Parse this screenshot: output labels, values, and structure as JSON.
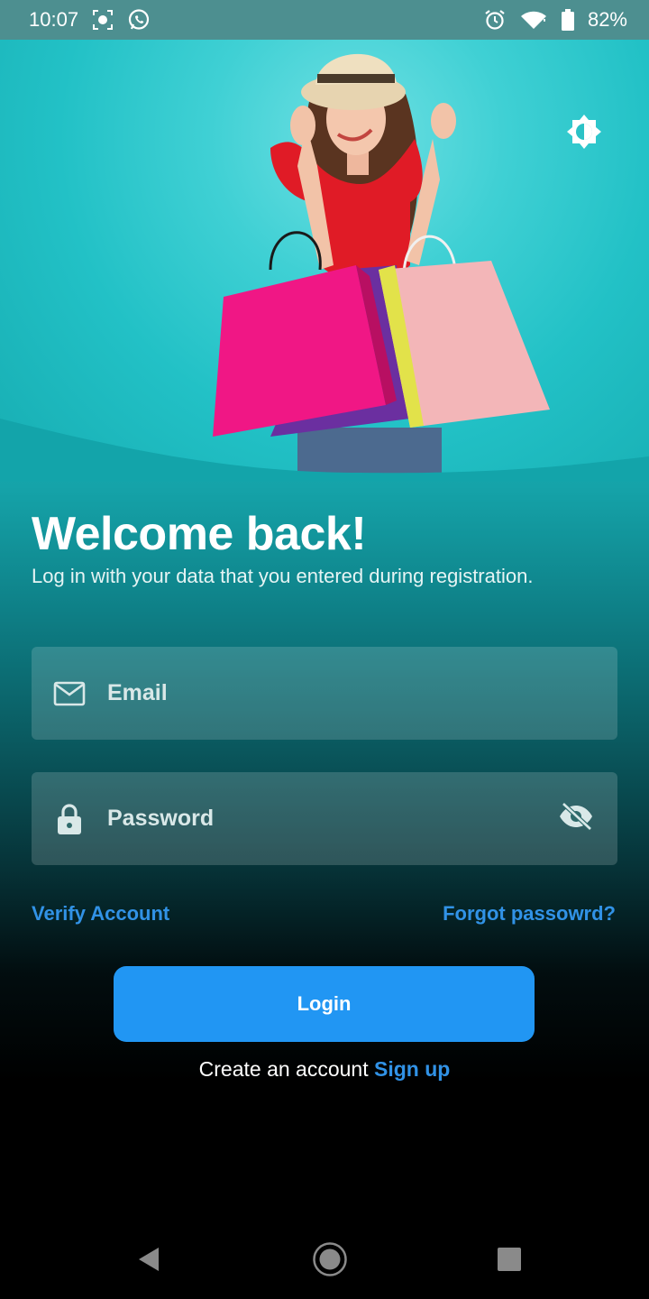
{
  "status_bar": {
    "time": "10:07",
    "battery": "82%",
    "icons": [
      "screen-record-icon",
      "whatsapp-icon",
      "alarm-icon",
      "wifi-icon",
      "battery-icon"
    ]
  },
  "hero": {
    "image": "woman-with-shopping-bags",
    "theme_icon": "brightness-icon"
  },
  "login": {
    "title": "Welcome back!",
    "subtitle": "Log in with your data that you entered during registration.",
    "email_placeholder": "Email",
    "password_placeholder": "Password",
    "verify_link": "Verify Account",
    "forgot_link": "Forgot passowrd?",
    "login_button": "Login",
    "create_account_text": "Create an account",
    "signup_link": "Sign up"
  },
  "colors": {
    "accent": "#2196f3",
    "link": "#3192e6",
    "teal": "#1fb7bc",
    "status_bar": "#4d8f90"
  },
  "nav_bar": {
    "icons": [
      "back-icon",
      "home-icon",
      "recents-icon"
    ]
  }
}
